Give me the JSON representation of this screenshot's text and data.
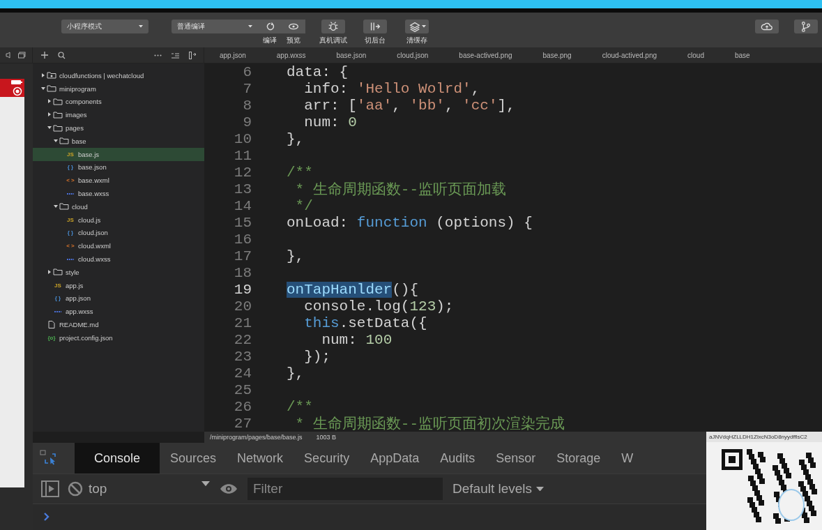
{
  "toolbar": {
    "mode_dropdown": "小程序模式",
    "compile_dropdown": "普通编译",
    "buttons": [
      {
        "label": "编译",
        "kind": "paired"
      },
      {
        "label": "预览",
        "kind": "paired"
      },
      {
        "label": "真机调试",
        "kind": "single"
      },
      {
        "label": "切后台",
        "kind": "single"
      },
      {
        "label": "清缓存",
        "kind": "dropdown"
      }
    ]
  },
  "editor_tabs": [
    "app.json",
    "app.wxss",
    "base.json",
    "cloud.json",
    "base-actived.png",
    "base.png",
    "cloud-actived.png",
    "cloud",
    "base"
  ],
  "file_tree": [
    {
      "name": "cloudfunctions | wechatcloud",
      "kind": "cloud-folder",
      "expanded": false,
      "selected": false
    },
    {
      "name": "miniprogram",
      "kind": "folder",
      "expanded": true,
      "selected": false,
      "children": [
        {
          "name": "components",
          "kind": "folder",
          "expanded": false,
          "selected": false
        },
        {
          "name": "images",
          "kind": "folder",
          "expanded": false,
          "selected": false
        },
        {
          "name": "pages",
          "kind": "folder",
          "expanded": true,
          "selected": false,
          "children": [
            {
              "name": "base",
              "kind": "folder",
              "expanded": true,
              "selected": false,
              "children": [
                {
                  "name": "base.js",
                  "kind": "js",
                  "glyph": "JS",
                  "selected": true
                },
                {
                  "name": "base.json",
                  "kind": "json",
                  "glyph": "{ }",
                  "selected": false
                },
                {
                  "name": "base.wxml",
                  "kind": "wxml",
                  "glyph": "< >",
                  "selected": false
                },
                {
                  "name": "base.wxss",
                  "kind": "wxss",
                  "selected": false
                }
              ]
            },
            {
              "name": "cloud",
              "kind": "folder",
              "expanded": true,
              "selected": false,
              "children": [
                {
                  "name": "cloud.js",
                  "kind": "js",
                  "glyph": "JS",
                  "selected": false
                },
                {
                  "name": "cloud.json",
                  "kind": "json",
                  "glyph": "{ }",
                  "selected": false
                },
                {
                  "name": "cloud.wxml",
                  "kind": "wxml",
                  "glyph": "< >",
                  "selected": false
                },
                {
                  "name": "cloud.wxss",
                  "kind": "wxss",
                  "selected": false
                }
              ]
            }
          ]
        },
        {
          "name": "style",
          "kind": "folder",
          "expanded": false,
          "selected": false
        },
        {
          "name": "app.js",
          "kind": "js",
          "glyph": "JS",
          "selected": false
        },
        {
          "name": "app.json",
          "kind": "json",
          "glyph": "{ }",
          "selected": false
        },
        {
          "name": "app.wxss",
          "kind": "wxss",
          "selected": false
        }
      ]
    },
    {
      "name": "README.md",
      "kind": "md",
      "selected": false
    },
    {
      "name": "project.config.json",
      "kind": "config",
      "glyph": "{o}",
      "selected": false
    }
  ],
  "code": [
    {
      "number": "6",
      "current": false,
      "tokens": [
        {
          "kind": "plain",
          "text": "data: {"
        }
      ]
    },
    {
      "number": "7",
      "current": false,
      "tokens": [
        {
          "kind": "plain",
          "text": "  info: "
        },
        {
          "kind": "string",
          "text": "'Hello Wolrd'"
        },
        {
          "kind": "plain",
          "text": ","
        }
      ]
    },
    {
      "number": "8",
      "current": false,
      "tokens": [
        {
          "kind": "plain",
          "text": "  arr: ["
        },
        {
          "kind": "string",
          "text": "'aa'"
        },
        {
          "kind": "plain",
          "text": ", "
        },
        {
          "kind": "string",
          "text": "'bb'"
        },
        {
          "kind": "plain",
          "text": ", "
        },
        {
          "kind": "string",
          "text": "'cc'"
        },
        {
          "kind": "plain",
          "text": "],"
        }
      ]
    },
    {
      "number": "9",
      "current": false,
      "tokens": [
        {
          "kind": "plain",
          "text": "  num: "
        },
        {
          "kind": "number",
          "text": "0"
        }
      ]
    },
    {
      "number": "10",
      "current": false,
      "tokens": [
        {
          "kind": "plain",
          "text": "},"
        }
      ]
    },
    {
      "number": "11",
      "current": false
    },
    {
      "number": "12",
      "current": false,
      "tokens": [
        {
          "kind": "comment",
          "text": "/**"
        }
      ]
    },
    {
      "number": "13",
      "current": false,
      "tokens": [
        {
          "kind": "comment",
          "text": " * 生命周期函数--监听页面加载"
        }
      ]
    },
    {
      "number": "14",
      "current": false,
      "tokens": [
        {
          "kind": "comment",
          "text": " */"
        }
      ]
    },
    {
      "number": "15",
      "current": false,
      "tokens": [
        {
          "kind": "plain",
          "text": "onLoad: "
        },
        {
          "kind": "keyword",
          "text": "function"
        },
        {
          "kind": "plain",
          "text": " (options) {"
        }
      ]
    },
    {
      "number": "16",
      "current": false
    },
    {
      "number": "17",
      "current": false,
      "tokens": [
        {
          "kind": "plain",
          "text": "},"
        }
      ]
    },
    {
      "number": "18",
      "current": false
    },
    {
      "number": "19",
      "current": true,
      "tokens": [
        {
          "kind": "selected",
          "text": "onTapHanlder"
        },
        {
          "kind": "plain",
          "text": "(){"
        }
      ]
    },
    {
      "number": "20",
      "current": false,
      "tokens": [
        {
          "kind": "plain",
          "text": "  console.log("
        },
        {
          "kind": "number",
          "text": "123"
        },
        {
          "kind": "plain",
          "text": ");"
        }
      ]
    },
    {
      "number": "21",
      "current": false,
      "tokens": [
        {
          "kind": "keyword",
          "text": "  this"
        },
        {
          "kind": "plain",
          "text": ".setData({"
        }
      ]
    },
    {
      "number": "22",
      "current": false,
      "tokens": [
        {
          "kind": "plain",
          "text": "    num: "
        },
        {
          "kind": "number",
          "text": "100"
        }
      ]
    },
    {
      "number": "23",
      "current": false,
      "tokens": [
        {
          "kind": "plain",
          "text": "  });"
        }
      ]
    },
    {
      "number": "24",
      "current": false,
      "tokens": [
        {
          "kind": "plain",
          "text": "},"
        }
      ]
    },
    {
      "number": "25",
      "current": false
    },
    {
      "number": "26",
      "current": false,
      "tokens": [
        {
          "kind": "comment",
          "text": "/**"
        }
      ]
    },
    {
      "number": "27",
      "current": false,
      "tokens": [
        {
          "kind": "comment",
          "text": " * 生命周期函数--监听页面初次渲染完成"
        }
      ]
    }
  ],
  "status_bar": {
    "path": "/miniprogram/pages/base/base.js",
    "size": "1003 B"
  },
  "devtools": {
    "tabs": [
      {
        "label": "Console",
        "selected": true
      },
      {
        "label": "Sources",
        "selected": false
      },
      {
        "label": "Network",
        "selected": false
      },
      {
        "label": "Security",
        "selected": false
      },
      {
        "label": "AppData",
        "selected": false
      },
      {
        "label": "Audits",
        "selected": false
      },
      {
        "label": "Sensor",
        "selected": false
      },
      {
        "label": "Storage",
        "selected": false
      },
      {
        "label": "W",
        "selected": false
      }
    ],
    "context": "top",
    "filter_placeholder": "Filter",
    "levels": "Default levels"
  },
  "qr_popup": {
    "code": "aJNVdqHZLLDH1ZlxcN3oD8nyydfflsC2"
  }
}
